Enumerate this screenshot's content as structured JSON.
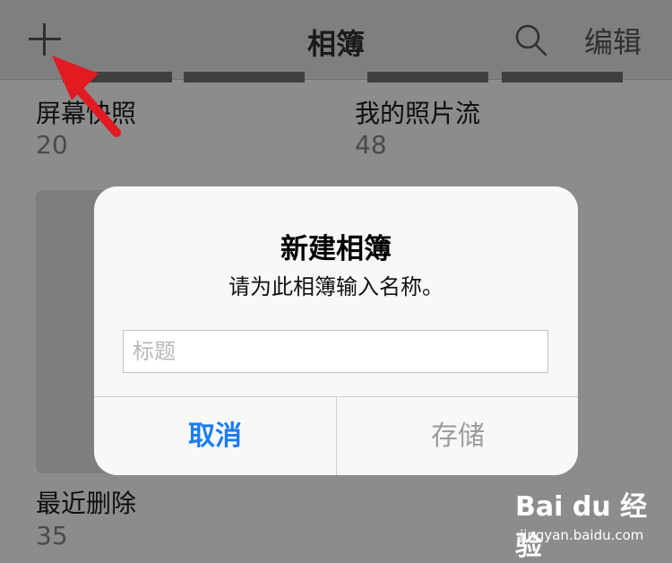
{
  "navbar": {
    "title": "相簿",
    "edit_label": "编辑",
    "add_icon": "plus-icon",
    "search_icon": "search-icon"
  },
  "albums": [
    {
      "name": "屏幕快照",
      "count": "20"
    },
    {
      "name": "我的照片流",
      "count": "48"
    },
    {
      "name": "最近删除",
      "count": "35"
    }
  ],
  "dialog": {
    "title": "新建相簿",
    "message": "请为此相簿输入名称。",
    "input_placeholder": "标题",
    "input_value": "",
    "cancel_label": "取消",
    "save_label": "存储"
  },
  "watermark": {
    "logo_text": "Bai du 经验",
    "url": "jingyan.baidu.com"
  },
  "colors": {
    "accent": "#1a7cf5",
    "annotation_arrow": "#e21b22",
    "disabled_text": "#9c9c9c"
  }
}
